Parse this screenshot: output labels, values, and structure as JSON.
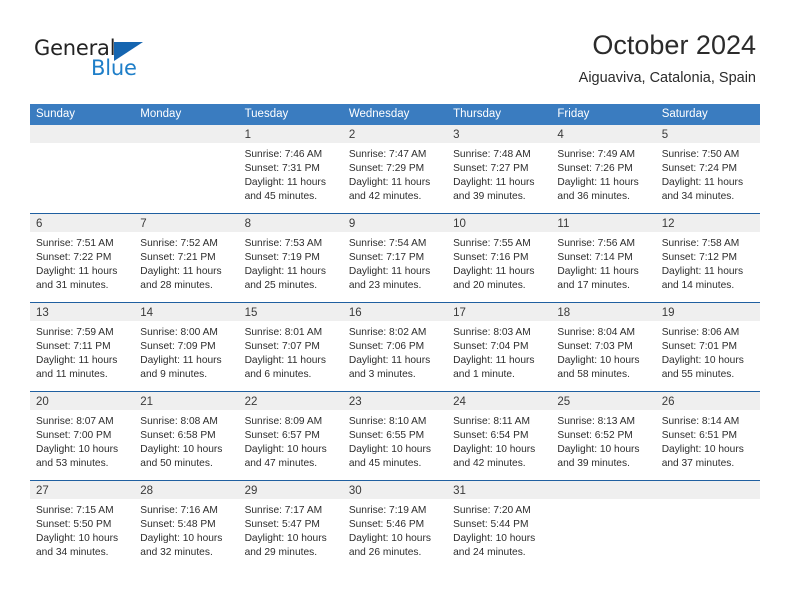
{
  "brand": {
    "word1": "General",
    "word2": "Blue",
    "accent_color": "#1e7ec8",
    "triangle_color": "#1565b0"
  },
  "header": {
    "title": "October 2024",
    "subtitle": "Aiguaviva, Catalonia, Spain"
  },
  "calendar": {
    "header_bg": "#3a7cc0",
    "row_divider_color": "#1f5fa0",
    "day_band_bg": "#efefef",
    "weekdays": [
      "Sunday",
      "Monday",
      "Tuesday",
      "Wednesday",
      "Thursday",
      "Friday",
      "Saturday"
    ],
    "weeks": [
      [
        {
          "day": "",
          "lines": []
        },
        {
          "day": "",
          "lines": []
        },
        {
          "day": "1",
          "lines": [
            "Sunrise: 7:46 AM",
            "Sunset: 7:31 PM",
            "Daylight: 11 hours",
            "and 45 minutes."
          ]
        },
        {
          "day": "2",
          "lines": [
            "Sunrise: 7:47 AM",
            "Sunset: 7:29 PM",
            "Daylight: 11 hours",
            "and 42 minutes."
          ]
        },
        {
          "day": "3",
          "lines": [
            "Sunrise: 7:48 AM",
            "Sunset: 7:27 PM",
            "Daylight: 11 hours",
            "and 39 minutes."
          ]
        },
        {
          "day": "4",
          "lines": [
            "Sunrise: 7:49 AM",
            "Sunset: 7:26 PM",
            "Daylight: 11 hours",
            "and 36 minutes."
          ]
        },
        {
          "day": "5",
          "lines": [
            "Sunrise: 7:50 AM",
            "Sunset: 7:24 PM",
            "Daylight: 11 hours",
            "and 34 minutes."
          ]
        }
      ],
      [
        {
          "day": "6",
          "lines": [
            "Sunrise: 7:51 AM",
            "Sunset: 7:22 PM",
            "Daylight: 11 hours",
            "and 31 minutes."
          ]
        },
        {
          "day": "7",
          "lines": [
            "Sunrise: 7:52 AM",
            "Sunset: 7:21 PM",
            "Daylight: 11 hours",
            "and 28 minutes."
          ]
        },
        {
          "day": "8",
          "lines": [
            "Sunrise: 7:53 AM",
            "Sunset: 7:19 PM",
            "Daylight: 11 hours",
            "and 25 minutes."
          ]
        },
        {
          "day": "9",
          "lines": [
            "Sunrise: 7:54 AM",
            "Sunset: 7:17 PM",
            "Daylight: 11 hours",
            "and 23 minutes."
          ]
        },
        {
          "day": "10",
          "lines": [
            "Sunrise: 7:55 AM",
            "Sunset: 7:16 PM",
            "Daylight: 11 hours",
            "and 20 minutes."
          ]
        },
        {
          "day": "11",
          "lines": [
            "Sunrise: 7:56 AM",
            "Sunset: 7:14 PM",
            "Daylight: 11 hours",
            "and 17 minutes."
          ]
        },
        {
          "day": "12",
          "lines": [
            "Sunrise: 7:58 AM",
            "Sunset: 7:12 PM",
            "Daylight: 11 hours",
            "and 14 minutes."
          ]
        }
      ],
      [
        {
          "day": "13",
          "lines": [
            "Sunrise: 7:59 AM",
            "Sunset: 7:11 PM",
            "Daylight: 11 hours",
            "and 11 minutes."
          ]
        },
        {
          "day": "14",
          "lines": [
            "Sunrise: 8:00 AM",
            "Sunset: 7:09 PM",
            "Daylight: 11 hours",
            "and 9 minutes."
          ]
        },
        {
          "day": "15",
          "lines": [
            "Sunrise: 8:01 AM",
            "Sunset: 7:07 PM",
            "Daylight: 11 hours",
            "and 6 minutes."
          ]
        },
        {
          "day": "16",
          "lines": [
            "Sunrise: 8:02 AM",
            "Sunset: 7:06 PM",
            "Daylight: 11 hours",
            "and 3 minutes."
          ]
        },
        {
          "day": "17",
          "lines": [
            "Sunrise: 8:03 AM",
            "Sunset: 7:04 PM",
            "Daylight: 11 hours",
            "and 1 minute."
          ]
        },
        {
          "day": "18",
          "lines": [
            "Sunrise: 8:04 AM",
            "Sunset: 7:03 PM",
            "Daylight: 10 hours",
            "and 58 minutes."
          ]
        },
        {
          "day": "19",
          "lines": [
            "Sunrise: 8:06 AM",
            "Sunset: 7:01 PM",
            "Daylight: 10 hours",
            "and 55 minutes."
          ]
        }
      ],
      [
        {
          "day": "20",
          "lines": [
            "Sunrise: 8:07 AM",
            "Sunset: 7:00 PM",
            "Daylight: 10 hours",
            "and 53 minutes."
          ]
        },
        {
          "day": "21",
          "lines": [
            "Sunrise: 8:08 AM",
            "Sunset: 6:58 PM",
            "Daylight: 10 hours",
            "and 50 minutes."
          ]
        },
        {
          "day": "22",
          "lines": [
            "Sunrise: 8:09 AM",
            "Sunset: 6:57 PM",
            "Daylight: 10 hours",
            "and 47 minutes."
          ]
        },
        {
          "day": "23",
          "lines": [
            "Sunrise: 8:10 AM",
            "Sunset: 6:55 PM",
            "Daylight: 10 hours",
            "and 45 minutes."
          ]
        },
        {
          "day": "24",
          "lines": [
            "Sunrise: 8:11 AM",
            "Sunset: 6:54 PM",
            "Daylight: 10 hours",
            "and 42 minutes."
          ]
        },
        {
          "day": "25",
          "lines": [
            "Sunrise: 8:13 AM",
            "Sunset: 6:52 PM",
            "Daylight: 10 hours",
            "and 39 minutes."
          ]
        },
        {
          "day": "26",
          "lines": [
            "Sunrise: 8:14 AM",
            "Sunset: 6:51 PM",
            "Daylight: 10 hours",
            "and 37 minutes."
          ]
        }
      ],
      [
        {
          "day": "27",
          "lines": [
            "Sunrise: 7:15 AM",
            "Sunset: 5:50 PM",
            "Daylight: 10 hours",
            "and 34 minutes."
          ]
        },
        {
          "day": "28",
          "lines": [
            "Sunrise: 7:16 AM",
            "Sunset: 5:48 PM",
            "Daylight: 10 hours",
            "and 32 minutes."
          ]
        },
        {
          "day": "29",
          "lines": [
            "Sunrise: 7:17 AM",
            "Sunset: 5:47 PM",
            "Daylight: 10 hours",
            "and 29 minutes."
          ]
        },
        {
          "day": "30",
          "lines": [
            "Sunrise: 7:19 AM",
            "Sunset: 5:46 PM",
            "Daylight: 10 hours",
            "and 26 minutes."
          ]
        },
        {
          "day": "31",
          "lines": [
            "Sunrise: 7:20 AM",
            "Sunset: 5:44 PM",
            "Daylight: 10 hours",
            "and 24 minutes."
          ]
        },
        {
          "day": "",
          "lines": []
        },
        {
          "day": "",
          "lines": []
        }
      ]
    ]
  }
}
